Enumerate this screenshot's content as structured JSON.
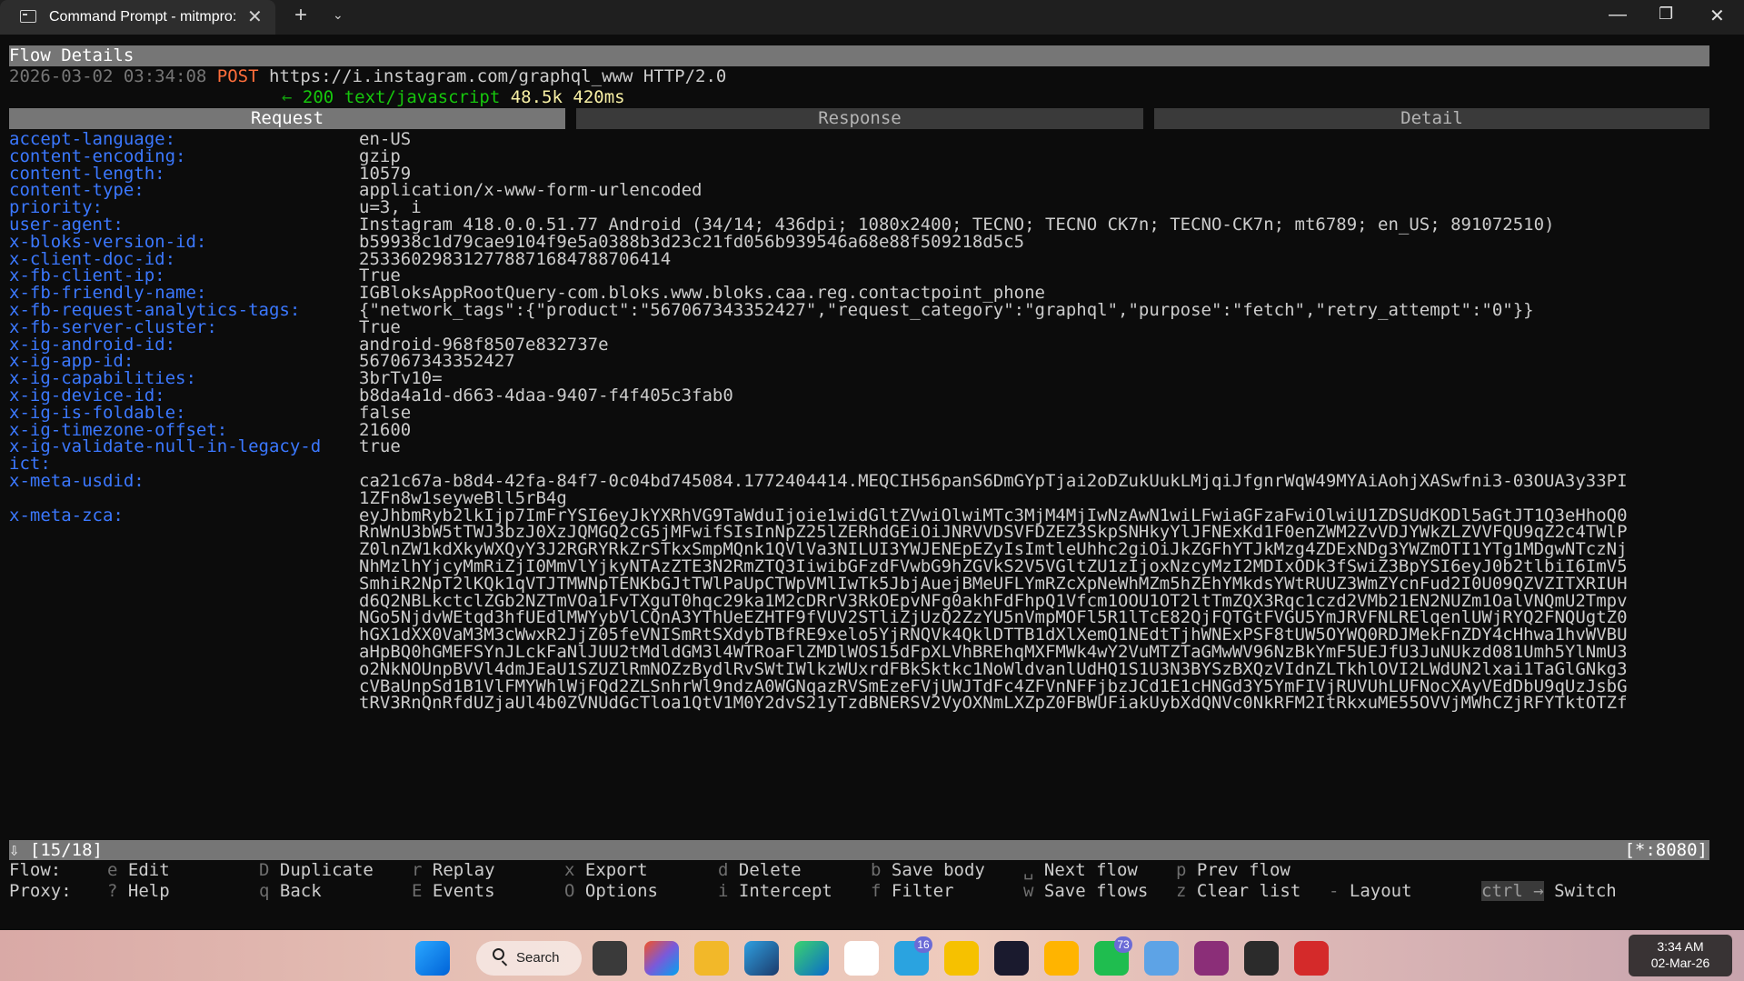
{
  "window": {
    "tab_title": "Command Prompt - mitmpro:",
    "minimize": "—",
    "maximize": "❐",
    "close": "✕",
    "new_tab": "+",
    "dropdown": "⌄",
    "tab_close": "✕"
  },
  "flow": {
    "header": "Flow Details",
    "timestamp": "2026-03-02 03:34:08",
    "method": "POST",
    "url": "https://i.instagram.com/graphql_www HTTP/2.0",
    "arrow": "←",
    "status": "200",
    "content_type": "text/javascript",
    "size": "48.5k",
    "time": "420ms"
  },
  "tabs": [
    "Request",
    "Response",
    "Detail"
  ],
  "headers": [
    {
      "key": "accept-language:",
      "value": "en-US"
    },
    {
      "key": "content-encoding:",
      "value": "gzip"
    },
    {
      "key": "content-length:",
      "value": "10579"
    },
    {
      "key": "content-type:",
      "value": "application/x-www-form-urlencoded"
    },
    {
      "key": "priority:",
      "value": "u=3, i"
    },
    {
      "key": "user-agent:",
      "value": "Instagram 418.0.0.51.77 Android (34/14; 436dpi; 1080x2400; TECNO; TECNO CK7n; TECNO-CK7n; mt6789; en_US; 891072510)"
    },
    {
      "key": "x-bloks-version-id:",
      "value": "b59938c1d79cae9104f9e5a0388b3d23c21fd056b939546a68e88f509218d5c5"
    },
    {
      "key": "x-client-doc-id:",
      "value": "253360298312778871684788706414"
    },
    {
      "key": "x-fb-client-ip:",
      "value": "True"
    },
    {
      "key": "x-fb-friendly-name:",
      "value": "IGBloksAppRootQuery-com.bloks.www.bloks.caa.reg.contactpoint_phone"
    },
    {
      "key": "x-fb-request-analytics-tags:",
      "value": "{\"network_tags\":{\"product\":\"567067343352427\",\"request_category\":\"graphql\",\"purpose\":\"fetch\",\"retry_attempt\":\"0\"}}"
    },
    {
      "key": "x-fb-server-cluster:",
      "value": "True"
    },
    {
      "key": "x-ig-android-id:",
      "value": "android-968f8507e832737e"
    },
    {
      "key": "x-ig-app-id:",
      "value": "567067343352427"
    },
    {
      "key": "x-ig-capabilities:",
      "value": "3brTv10="
    },
    {
      "key": "x-ig-device-id:",
      "value": "b8da4a1d-d663-4daa-9407-f4f405c3fab0"
    },
    {
      "key": "x-ig-is-foldable:",
      "value": "false"
    },
    {
      "key": "x-ig-timezone-offset:",
      "value": "21600"
    },
    {
      "key": "x-ig-validate-null-in-legacy-d",
      "value": "true"
    },
    {
      "key": "ict:",
      "value": ""
    },
    {
      "key": "x-meta-usdid:",
      "value": "ca21c67a-b8d4-42fa-84f7-0c04bd745084.1772404414.MEQCIH56panS6DmGYpTjai2oDZukUukLMjqiJfgnrWqW49MYAiAohjXASwfni3-03OUA3y33PI"
    },
    {
      "key": "",
      "value": "1ZFn8w1seyweBll5rB4g"
    },
    {
      "key": "x-meta-zca:",
      "value": "eyJhbmRyb2lkIjp7ImFrYSI6eyJkYXRhVG9TaWduIjoie1widGltZVwiOlwiMTc3MjM4MjIwNzAwN1wiLFwiaGFzaFwiOlwiU1ZDSUdKODl5aGtJT1Q3eHhoQ0"
    },
    {
      "key": "",
      "value": "RnWnU3bW5tTWJ3bzJ0XzJQMGQ2cG5jMFwifSIsInNpZ25lZERhdGEiOiJNRVVDSVFDZEZ3SkpSNHkyYlJFNExKd1F0enZWM2ZvVDJYWkZLZVVFQU9qZ2c4TWlP"
    },
    {
      "key": "",
      "value": "Z0lnZW1kdXkyWXQyY3J2RGRYRkZrSTkxSmpMQnk1QVlVa3NILUI3YWJENEpEZyIsImtleUhhc2giOiJkZGFhYTJkMzg4ZDExNDg3YWZmOTI1YTg1MDgwNTczNj"
    },
    {
      "key": "",
      "value": "NhMzlhYjcyMmRiZjI0MmVlYjkyNTAzZTE3N2RmZTQ3IiwibGFzdFVwbG9hZGVkS2V5VGltZU1zIjoxNzcyMzI2MDIxODk3fSwiZ3BpYSI6eyJ0b2tlbiI6ImV5"
    },
    {
      "key": "",
      "value": "SmhiR2NpT2lKQk1qVTJTMWNpTENKbGJtTWlPaUpCTWpVMlIwTk5JbjAuejBMeUFLYmRZcXpNeWhMZm5hZEhYMkdsYWtRUUZ3WmZYcnFud2I0U09QZVZITXRIUH"
    },
    {
      "key": "",
      "value": "d6Q2NBLkctclZGb2NZTmVOa1FvTXguT0hqc29ka1M2cDRrV3RkOEpvNFg0akhFdFhpQ1Vfcm1OOU1OT2ltTmZQX3Rqc1czd2VMb21EN2NUZm1OalVNQmU2Tmpv"
    },
    {
      "key": "",
      "value": "NGo5NjdvWEtqd3hfUEdlMWYybVlCQnA3YThUeEZHTF9fVUV2STliZjUzQ2ZzYU5nVmpMOFl5R1lTcE82QjFQTGtFVGU5YmJRVFNLRElqenlUWjRYQ2FNQUgtZ0"
    },
    {
      "key": "",
      "value": "hGX1dXX0VaM3M3cWwxR2JjZ05feVNISmRtSXdybTBfRE9xelo5YjRNQVk4QklDTTB1dXlXemQ1NEdtTjhWNExPSF8tUW5OYWQ0RDJMekFnZDY4cHhwa1hvWVBU"
    },
    {
      "key": "",
      "value": "aHpBQ0hGMEFSYnJLckFaNlJUU2tMdldGM3l4WTRoaFlZMDlWOS15dFpXLVhBREhqMXFMWk4wY2VuMTZTaGMwWV96NzBkYmF5UEJfU3JuNUkzd081Umh5YlNmU3"
    },
    {
      "key": "",
      "value": "o2NkNOUnpBVVl4dmJEaU1SZUZlRmNOZzBydlRvSWtIWlkzWUxrdFBkSktkc1NoWldvanlUdHQ1S1U3N3BYSzBXQzVIdnZLTkhlOVI2LWdUN2lxai1TaGlGNkg3"
    },
    {
      "key": "",
      "value": "cVBaUnpSd1B1VlFMYWhlWjFQd2ZLSnhrWl9ndzA0WGNqazRVSmEzeFVjUWJTdFc4ZFVnNFFjbzJCd1E1cHNGd3Y5YmFIVjRUVUhLUFNocXAyVEdDbU9qUzJsbG"
    },
    {
      "key": "",
      "value": "tRV3RnQnRfdUZjaUl4b0ZVNUdGcTloa1QtV1M0Y2dvS21yTzdBNERSV2VyOXNmLXZpZ0FBWUFiakUybXdQNVc0NkRFM2ItRkxuME55OVVjMWhCZjRFYTktOTZf"
    }
  ],
  "status_bar": {
    "left": "⇩  [15/18]",
    "right": "[*:8080]"
  },
  "keybindings": {
    "row1_label": "Flow:",
    "row2_label": "Proxy:",
    "row1": [
      {
        "key": "e",
        "desc": "Edit"
      },
      {
        "key": "D",
        "desc": "Duplicate"
      },
      {
        "key": "r",
        "desc": "Replay"
      },
      {
        "key": "x",
        "desc": "Export"
      },
      {
        "key": "d",
        "desc": "Delete"
      },
      {
        "key": "b",
        "desc": "Save body"
      },
      {
        "key": "␣",
        "desc": "Next flow"
      },
      {
        "key": "p",
        "desc": "Prev flow"
      }
    ],
    "row2": [
      {
        "key": "?",
        "desc": "Help"
      },
      {
        "key": "q",
        "desc": "Back"
      },
      {
        "key": "E",
        "desc": "Events"
      },
      {
        "key": "O",
        "desc": "Options"
      },
      {
        "key": "i",
        "desc": "Intercept"
      },
      {
        "key": "f",
        "desc": "Filter"
      },
      {
        "key": "w",
        "desc": "Save flows"
      },
      {
        "key": "z",
        "desc": "Clear list"
      },
      {
        "key": "-",
        "desc": "Layout"
      },
      {
        "key": "ctrl →",
        "desc": "Switch"
      }
    ]
  },
  "taskbar": {
    "search_label": "Search",
    "time": "3:34 AM",
    "date": "02-Mar-26",
    "telegram_badge": "16",
    "whatsapp_badge": "73",
    "icons": [
      "windows-start-icon",
      "task-view-icon",
      "microsoft-365-icon",
      "file-explorer-icon",
      "edge-dev-icon",
      "edge-icon",
      "microsoft-store-icon",
      "telegram-icon",
      "app-icon",
      "azure-icon",
      "app-launcher-icon",
      "whatsapp-icon",
      "remote-desktop-icon",
      "winrar-icon",
      "terminal-icon",
      "mitmproxy-icon"
    ]
  },
  "colors": {
    "header_key": "#3b78ff",
    "method": "#ff6e3b",
    "status_ok": "#16c60c",
    "size_time": "#f9f1a5",
    "arrow": "#13a10e"
  }
}
